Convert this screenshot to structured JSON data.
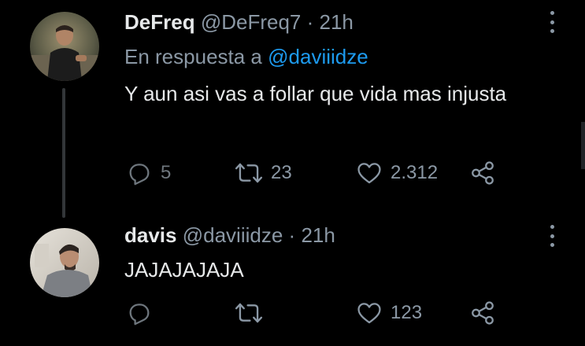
{
  "tweets": [
    {
      "name": "DeFreq",
      "handle": "@DeFreq7",
      "separator": "·",
      "time": "21h",
      "reply_prefix": "En respuesta a",
      "reply_mention": "@daviiidze",
      "text": "Y aun asi vas a follar que vida mas injusta",
      "replies": "5",
      "retweets": "23",
      "likes": "2.312",
      "icons": [
        "reply-icon",
        "retweet-icon",
        "like-icon",
        "share-icon",
        "more-icon"
      ]
    },
    {
      "name": "davis",
      "handle": "@daviiidze",
      "separator": "·",
      "time": "21h",
      "text": "JAJAJAJAJA",
      "replies": "",
      "retweets": "",
      "likes": "123",
      "icons": [
        "reply-icon",
        "retweet-icon",
        "like-icon",
        "share-icon",
        "more-icon"
      ]
    }
  ],
  "colors": {
    "background": "#000000",
    "text": "#e7e9ea",
    "secondary": "#8b98a5",
    "accent": "#1d9bf0",
    "thread_line": "#333639"
  }
}
